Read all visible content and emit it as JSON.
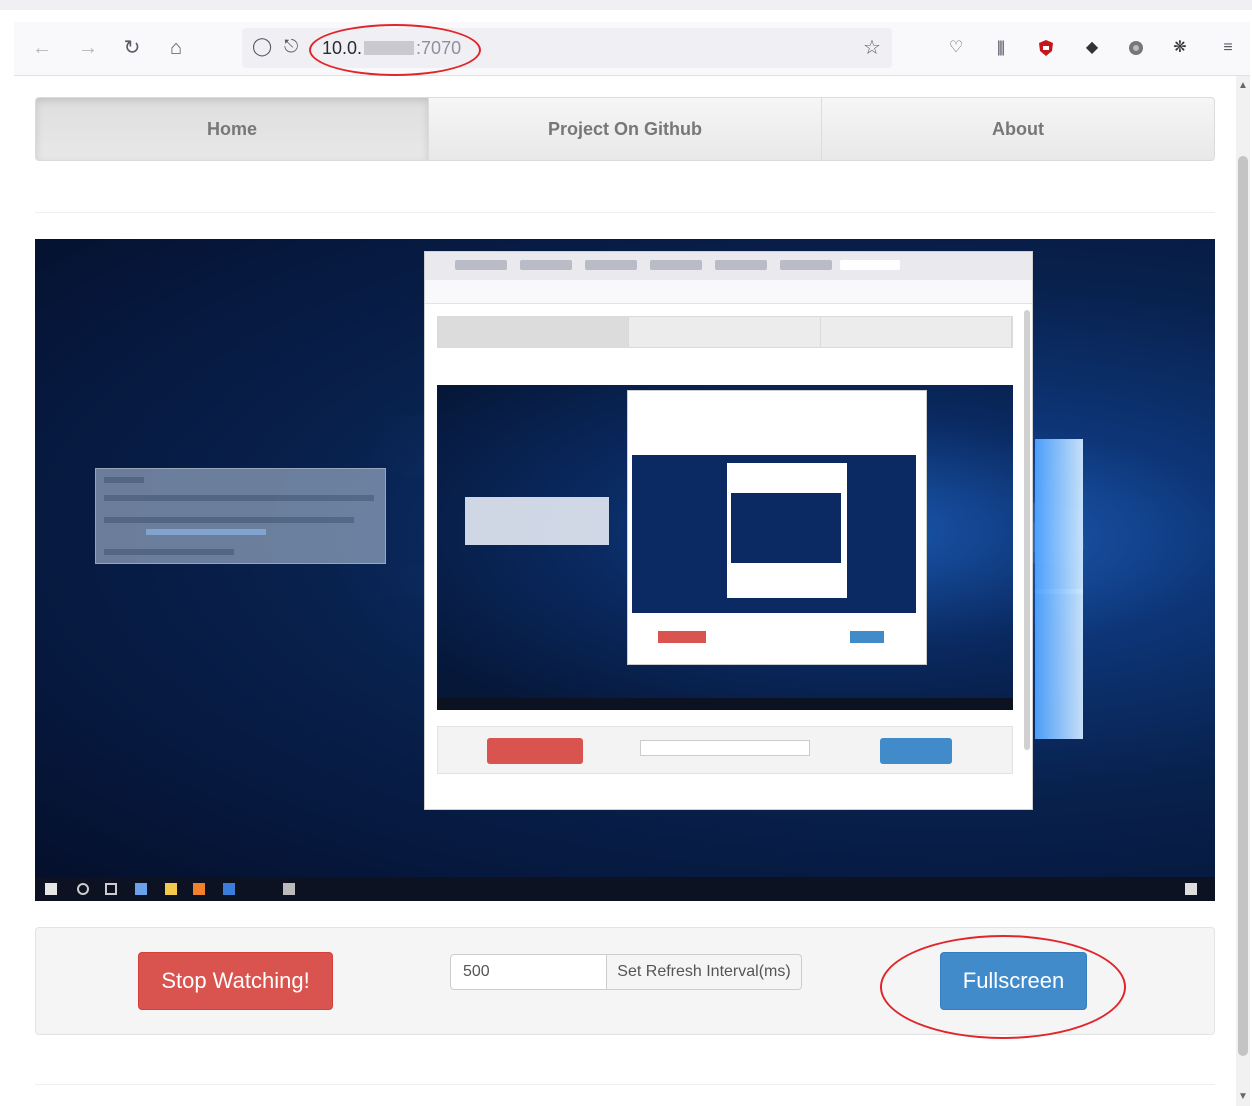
{
  "browser": {
    "url": {
      "host": "10.0.",
      "port": ":7070"
    },
    "icons": [
      "back-icon",
      "forward-icon",
      "reload-icon",
      "home-icon",
      "shield-icon",
      "lock-icon",
      "star-icon",
      "pocket-icon",
      "library-icon",
      "ublock-icon",
      "evernote-icon",
      "extension-icon",
      "extensions-icon",
      "menu-icon"
    ]
  },
  "nav": {
    "items": [
      {
        "label": "Home",
        "active": true
      },
      {
        "label": "Project On Github",
        "active": false
      },
      {
        "label": "About",
        "active": false
      }
    ]
  },
  "controls": {
    "stop_label": "Stop Watching!",
    "interval_value": "500",
    "interval_label": "Set Refresh Interval(ms)",
    "fullscreen_label": "Fullscreen"
  },
  "colors": {
    "danger": "#d9534f",
    "primary": "#428bca",
    "annotation": "#e0262b"
  }
}
